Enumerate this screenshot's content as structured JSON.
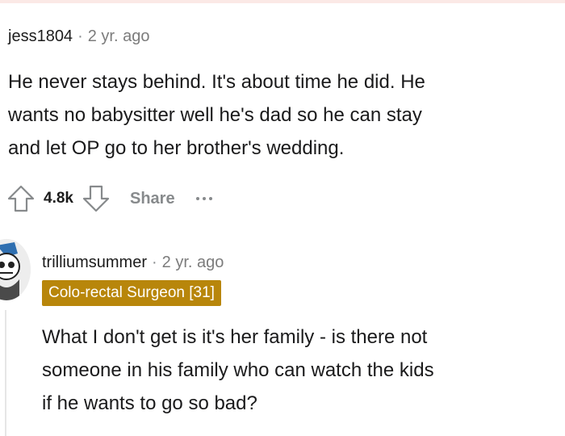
{
  "top_comment": {
    "username": "jess1804",
    "separator": "·",
    "timestamp": "2 yr. ago",
    "body_lines": [
      "He never stays behind. It's about time he did. He",
      "wants no babysitter well he's dad so he can stay",
      "and let OP go to her brother's wedding."
    ],
    "vote_count": "4.8k",
    "share_label": "Share",
    "upvote_icon": "upvote-arrow-icon",
    "downvote_icon": "downvote-arrow-icon",
    "more_icon": "more-options-icon"
  },
  "reply": {
    "username": "trilliumsummer",
    "separator": "·",
    "timestamp": "2 yr. ago",
    "flair": "Colo-rectal Surgeon [31]",
    "flair_color": "#b8860b",
    "body_lines": [
      "What I don't get is it's her family - is there not",
      "someone in his family who can watch the kids",
      "if he wants to go so bad?"
    ]
  }
}
